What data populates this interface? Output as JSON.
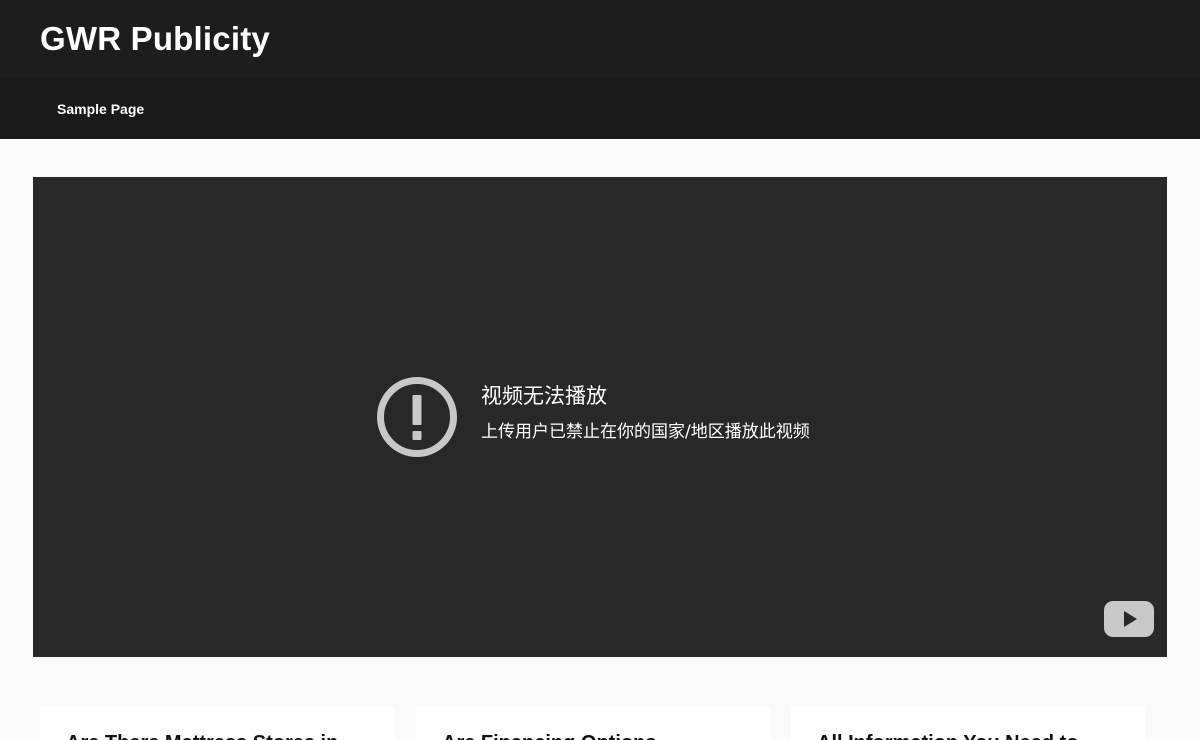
{
  "header": {
    "site_title": "GWR Publicity"
  },
  "nav": {
    "items": [
      {
        "label": "Sample Page"
      }
    ]
  },
  "video": {
    "error_title": "视频无法播放",
    "error_message": "上传用户已禁止在你的国家/地区播放此视频",
    "icon": "alert-circle-icon",
    "logo": "youtube-logo-icon"
  },
  "posts": [
    {
      "title": "Are There Mattress Stores in"
    },
    {
      "title": "Are Financing Options"
    },
    {
      "title": "All Information You Need to"
    }
  ],
  "colors": {
    "header_bg": "#1d1d1d",
    "nav_bg": "#1a1a1a",
    "page_bg": "#fafafa",
    "player_bg": "#282828",
    "icon_grey": "#c8c8c8"
  }
}
